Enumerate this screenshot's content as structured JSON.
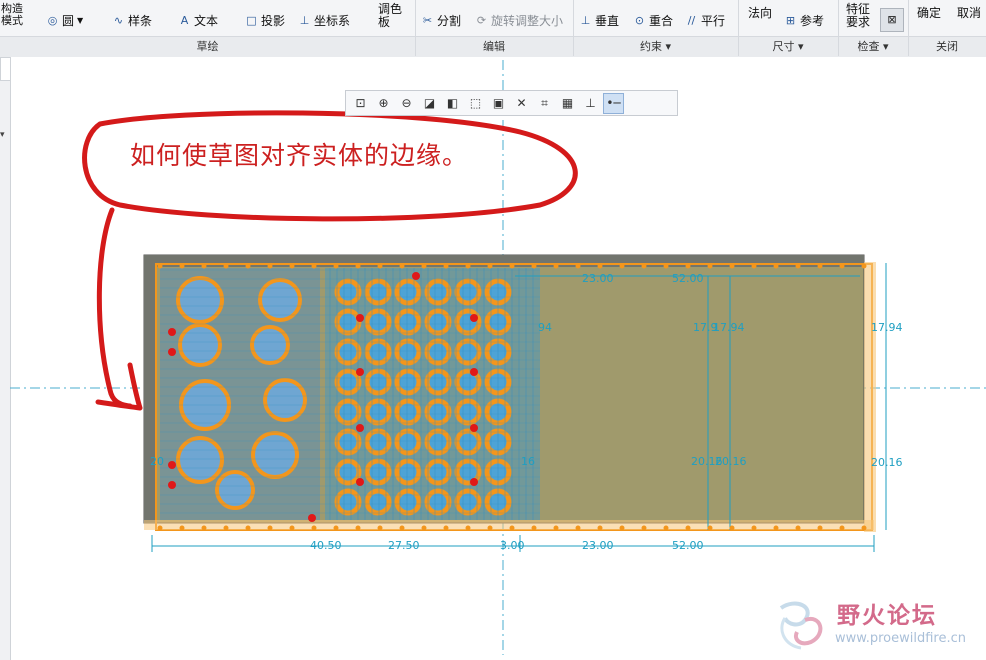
{
  "ribbon": {
    "groups": {
      "sketch": {
        "label": "草绘"
      },
      "edit": {
        "label": "编辑"
      },
      "constrain": {
        "label": "约束 ▾"
      },
      "dimension": {
        "label": "尺寸 ▾"
      },
      "inspect": {
        "label": "检查 ▾"
      },
      "close": {
        "label": "关闭"
      }
    },
    "construction_mode": "构造\n模式",
    "circle": "圆",
    "spline": "样条",
    "text": "文本",
    "project": "投影",
    "coord_sys": "坐标系",
    "palette": "调色\n板",
    "divide": "分割",
    "rotate_resize": "旋转调整大小",
    "perpendicular": "垂直",
    "coincident": "重合",
    "parallel": "平行",
    "normal": "法向",
    "reference": "参考",
    "feature_req": "特征\n要求",
    "ok": "确定",
    "cancel": "取消"
  },
  "view_toolbar": {
    "icons": [
      "refit-icon",
      "zoom-in-icon",
      "zoom-out-icon",
      "repaint-icon",
      "display-style-icon",
      "saved-orientations-icon",
      "view-manager-icon",
      "datum-display-icon",
      "sketch-view-icon",
      "sketcher-display-icon",
      "disp-constraints-icon",
      "disp-vertices-icon"
    ]
  },
  "annotation": {
    "text": "如何使草图对齐实体的边缘。"
  },
  "dimensions": {
    "top_left_a": "23.00",
    "top_right_a": "52.00",
    "right_upper": "17.94",
    "right_lower": "20.16",
    "mid_upper": "17.9",
    "mid_upper2": "17.94",
    "mid_lower": "20.16",
    "mid_lower2": "20.16",
    "left_upper": "94",
    "left_lower": "16",
    "bottom_a": "40.50",
    "bottom_b": "27.50",
    "bottom_c": "3.00",
    "bottom_d": "23.00",
    "bottom_e": "52.00",
    "far_left": "20"
  },
  "watermark": {
    "name": "野火论坛",
    "url": "www.proewildfire.cn"
  },
  "colors": {
    "solid_fill": "#a09a6c",
    "sketch_orange": "#f3961c",
    "dim_blue": "#1f9fc2",
    "annotation_red": "#cc2020"
  }
}
